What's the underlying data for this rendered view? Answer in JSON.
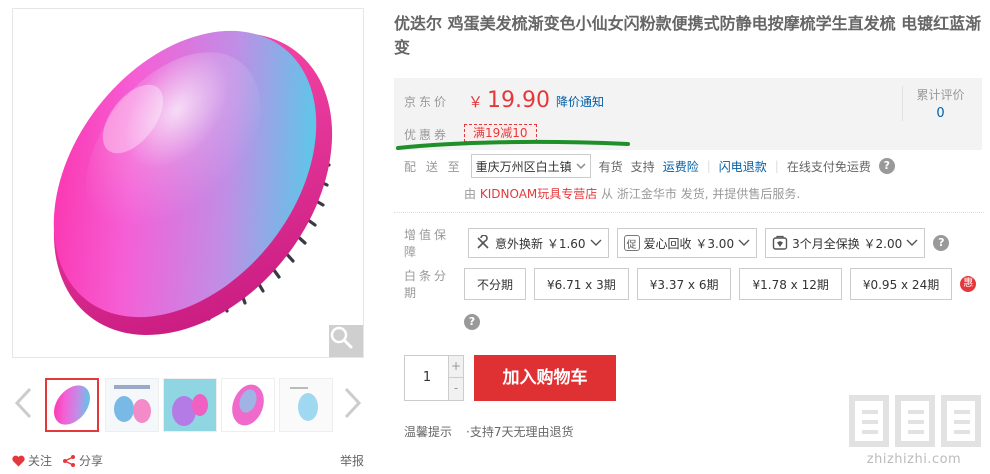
{
  "product": {
    "title": "优迭尔 鸡蛋美发梳渐变色小仙女闪粉款便携式防静电按摩梳学生直发梳 电镀红蓝渐变"
  },
  "gallery": {
    "thumbnail_count": 5,
    "active_index": 0,
    "zoom_icon": "magnifier-icon",
    "follow_label": "关注",
    "share_label": "分享",
    "report_label": "举报"
  },
  "price": {
    "label": "京东价",
    "currency": "￥",
    "value": "19.90",
    "notify_label": "降价通知",
    "color": "#e4393c"
  },
  "rating": {
    "label": "累计评价",
    "count": "0"
  },
  "coupon": {
    "label": "优惠券",
    "tag": "满19减10"
  },
  "shipping": {
    "label": "配 送 至",
    "location": "重庆万州区白土镇",
    "stock": "有货",
    "support_label": "支持",
    "option_1": "运费险",
    "option_2": "闪电退款",
    "option_3": "在线支付免运费"
  },
  "seller": {
    "prefix": "由",
    "shop": "KIDNOAM玩具专营店",
    "suffix": "从 浙江金华市 发货, 并提供售后服务."
  },
  "services": {
    "label": "增值保障",
    "items": [
      {
        "icon": "wrench-icon",
        "label": "意外换新 ￥1.60"
      },
      {
        "icon": "recycle-icon",
        "label": "爱心回收 ￥3.00"
      },
      {
        "icon": "shield-icon",
        "label": "3个月全保换 ￥2.00"
      }
    ]
  },
  "installments": {
    "label": "白条分期",
    "options": [
      "不分期",
      "¥6.71 x 3期",
      "¥3.37 x 6期",
      "¥1.78 x 12期",
      "¥0.95 x 24期"
    ],
    "badge": "惠"
  },
  "purchase": {
    "quantity": "1",
    "plus": "+",
    "minus": "-",
    "add_to_cart": "加入购物车"
  },
  "tips": {
    "label": "温馨提示",
    "item": "·支持7天无理由退货"
  },
  "watermark": {
    "url": "zhizhizhi.com"
  },
  "colors": {
    "brand_red": "#e4393c",
    "link_blue": "#005ea7",
    "price_box_bg": "#f3f3f3"
  }
}
